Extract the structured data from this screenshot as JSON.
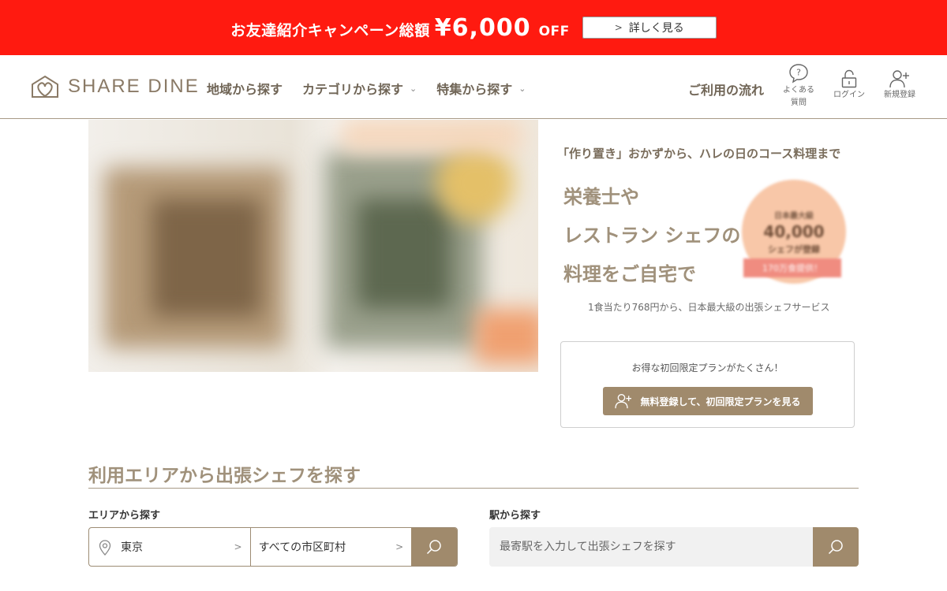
{
  "banner": {
    "text": "お友達紹介キャンペーン総額",
    "amount": "¥6,000",
    "off": "OFF",
    "button_label": "詳しく見る",
    "bg_color": "#ff1a10"
  },
  "header": {
    "logo_text": "SHARE DINE",
    "nav": [
      {
        "label": "地域から探す",
        "has_dropdown": false
      },
      {
        "label": "カテゴリから探す",
        "has_dropdown": true
      },
      {
        "label": "特集から探す",
        "has_dropdown": true
      }
    ],
    "flow_link": "ご利用の流れ",
    "icons": [
      {
        "icon": "question-icon",
        "label_line1": "よくある",
        "label_line2": "質問"
      },
      {
        "icon": "lock-icon",
        "label_line1": "ログイン",
        "label_line2": ""
      },
      {
        "icon": "user-plus-icon",
        "label_line1": "新規登録",
        "label_line2": ""
      }
    ]
  },
  "hero": {
    "tagline": "「作り置き」おかずから、ハレの日のコース料理まで",
    "headline": [
      "栄養士や",
      "レストラン シェフの",
      "料理をご自宅で"
    ],
    "badge": {
      "line1": "日本最大級",
      "line2": "40,000",
      "line3": "シェフが登録",
      "ribbon": "170万食提供！"
    },
    "subline": "1食当たり768円から、日本最大級の出張シェフサービス",
    "promo": {
      "text": "お得な初回限定プランがたくさん！",
      "button_label": "無料登録して、初回限定プランを見る"
    }
  },
  "search": {
    "section_title": "利用エリアから出張シェフを探す",
    "area_label": "エリアから探す",
    "prefecture": "東京",
    "city": "すべての市区町村",
    "station_label": "駅から探す",
    "station_placeholder": "最寄駅を入力して出張シェフを探す"
  },
  "colors": {
    "accent": "#a08a6c",
    "heading": "#a0917b",
    "border": "#a89a86"
  }
}
